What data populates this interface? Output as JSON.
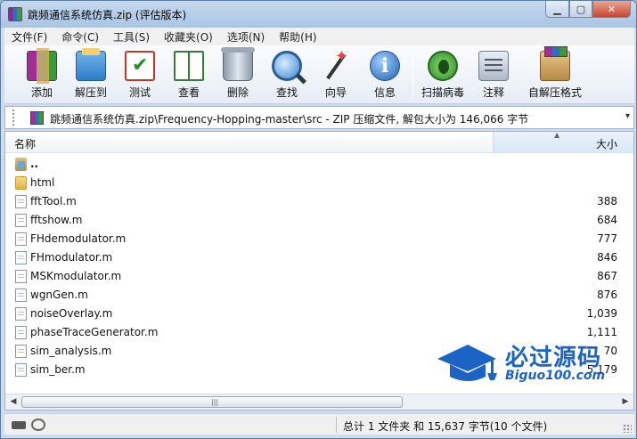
{
  "window": {
    "title": "跳频通信系统仿真.zip (评估版本)",
    "controls": {
      "minimize": "▁",
      "maximize": "▢",
      "close": "✕"
    }
  },
  "menu": [
    "文件(F)",
    "命令(C)",
    "工具(S)",
    "收藏夹(O)",
    "选项(N)",
    "帮助(H)"
  ],
  "toolbar": [
    {
      "label": "添加",
      "icon": "add-archive-icon"
    },
    {
      "label": "解压到",
      "icon": "extract-to-icon"
    },
    {
      "label": "测试",
      "icon": "test-icon"
    },
    {
      "label": "查看",
      "icon": "view-book-icon"
    },
    {
      "label": "删除",
      "icon": "trash-icon"
    },
    {
      "label": "查找",
      "icon": "magnifier-icon"
    },
    {
      "label": "向导",
      "icon": "wizard-wand-icon"
    },
    {
      "label": "信息",
      "icon": "info-icon"
    },
    {
      "label": "扫描病毒",
      "icon": "virus-scan-icon"
    },
    {
      "label": "注释",
      "icon": "comment-icon"
    },
    {
      "label": "自解压格式",
      "icon": "sfx-box-icon"
    }
  ],
  "address": {
    "path": "跳频通信系统仿真.zip\\Frequency-Hopping-master\\src - ZIP 压缩文件, 解包大小为 146,066 字节",
    "dropdown": "▾"
  },
  "columns": {
    "name": "名称",
    "size": "大小",
    "sort_indicator": "▲"
  },
  "files": [
    {
      "name": "..",
      "size": "",
      "type": "folder-up"
    },
    {
      "name": "html",
      "size": "",
      "type": "folder"
    },
    {
      "name": "fftTool.m",
      "size": "388",
      "type": "file"
    },
    {
      "name": "fftshow.m",
      "size": "684",
      "type": "file"
    },
    {
      "name": "FHdemodulator.m",
      "size": "777",
      "type": "file"
    },
    {
      "name": "FHmodulator.m",
      "size": "846",
      "type": "file"
    },
    {
      "name": "MSKmodulator.m",
      "size": "867",
      "type": "file"
    },
    {
      "name": "wgnGen.m",
      "size": "876",
      "type": "file"
    },
    {
      "name": "noiseOverlay.m",
      "size": "1,039",
      "type": "file"
    },
    {
      "name": "phaseTraceGenerator.m",
      "size": "1,111",
      "type": "file"
    },
    {
      "name": "sim_analysis.m",
      "size": "70",
      "type": "file"
    },
    {
      "name": "sim_ber.m",
      "size": "5,179",
      "type": "file"
    }
  ],
  "watermark": {
    "title": "必过源码",
    "url": "Biguo100.com"
  },
  "scrollbar": {
    "left": "◀",
    "right": "▶",
    "grip": "|||"
  },
  "status": {
    "summary": "总计 1 文件夹 和 15,637 字节(10 个文件)"
  },
  "colors": {
    "accent": "#1b63c4",
    "window_frame": "#a9c4e3"
  }
}
